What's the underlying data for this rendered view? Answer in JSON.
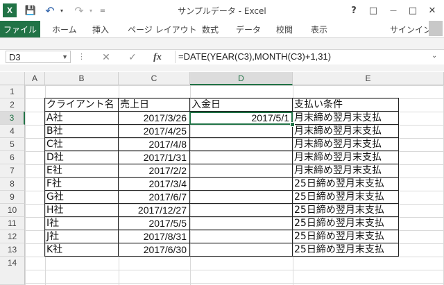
{
  "window": {
    "title": "サンプルデータ - Excel",
    "help": "?",
    "restore": "□",
    "minimize": "—",
    "maximize": "□",
    "close": "✕"
  },
  "quick_access": {
    "app_logo": "X",
    "save": "💾",
    "undo": "↶",
    "redo": "↷",
    "customize": "="
  },
  "ribbon": {
    "file": "ファイル",
    "tabs": [
      "ホーム",
      "挿入",
      "ページ レイアウト",
      "数式",
      "データ",
      "校閲",
      "表示"
    ],
    "signin": "サインイン"
  },
  "formula_bar": {
    "name_box": "D3",
    "cancel": "✕",
    "enter": "✓",
    "fx": "fx",
    "formula": "=DATE(YEAR(C3),MONTH(C3)+1,31)"
  },
  "columns": [
    "A",
    "B",
    "C",
    "D",
    "E"
  ],
  "rows": [
    "1",
    "2",
    "3",
    "4",
    "5",
    "6",
    "7",
    "8",
    "9",
    "10",
    "11",
    "12",
    "13",
    "14"
  ],
  "table": {
    "headers": [
      "クライアント名",
      "売上日",
      "入金日",
      "支払い条件"
    ],
    "rows": [
      [
        "A社",
        "2017/3/26",
        "2017/5/1",
        "月末締め翌月末支払"
      ],
      [
        "B社",
        "2017/4/25",
        "",
        "月末締め翌月末支払"
      ],
      [
        "C社",
        "2017/4/8",
        "",
        "月末締め翌月末支払"
      ],
      [
        "D社",
        "2017/1/31",
        "",
        "月末締め翌月末支払"
      ],
      [
        "E社",
        "2017/2/2",
        "",
        "月末締め翌月末支払"
      ],
      [
        "F社",
        "2017/3/4",
        "",
        "25日締め翌月末支払"
      ],
      [
        "G社",
        "2017/6/7",
        "",
        "25日締め翌月末支払"
      ],
      [
        "H社",
        "2017/12/27",
        "",
        "25日締め翌月末支払"
      ],
      [
        "I社",
        "2017/5/5",
        "",
        "25日締め翌月末支払"
      ],
      [
        "J社",
        "2017/8/31",
        "",
        "25日締め翌月末支払"
      ],
      [
        "K社",
        "2017/6/30",
        "",
        "25日締め翌月末支払"
      ]
    ]
  },
  "colors": {
    "accent": "#217346"
  }
}
